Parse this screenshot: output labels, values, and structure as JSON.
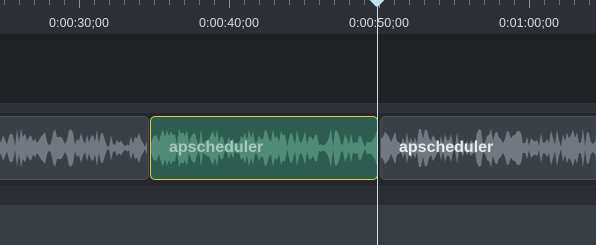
{
  "ruler": {
    "labels": [
      "0:00:30;00",
      "0:00:40;00",
      "0:00:50;00",
      "0:01:00;00"
    ]
  },
  "tracks": {
    "audio_clips": [
      {
        "label": ""
      },
      {
        "label": "apscheduler",
        "selected": true
      },
      {
        "label": "apscheduler"
      }
    ]
  },
  "colors": {
    "playhead": "#bfe3ee",
    "selection_border": "#e3c64a",
    "selected_clip_fill": "#2c5d4e",
    "clip_fill": "#3b4047"
  },
  "icons": {
    "playhead": "playhead-icon"
  }
}
